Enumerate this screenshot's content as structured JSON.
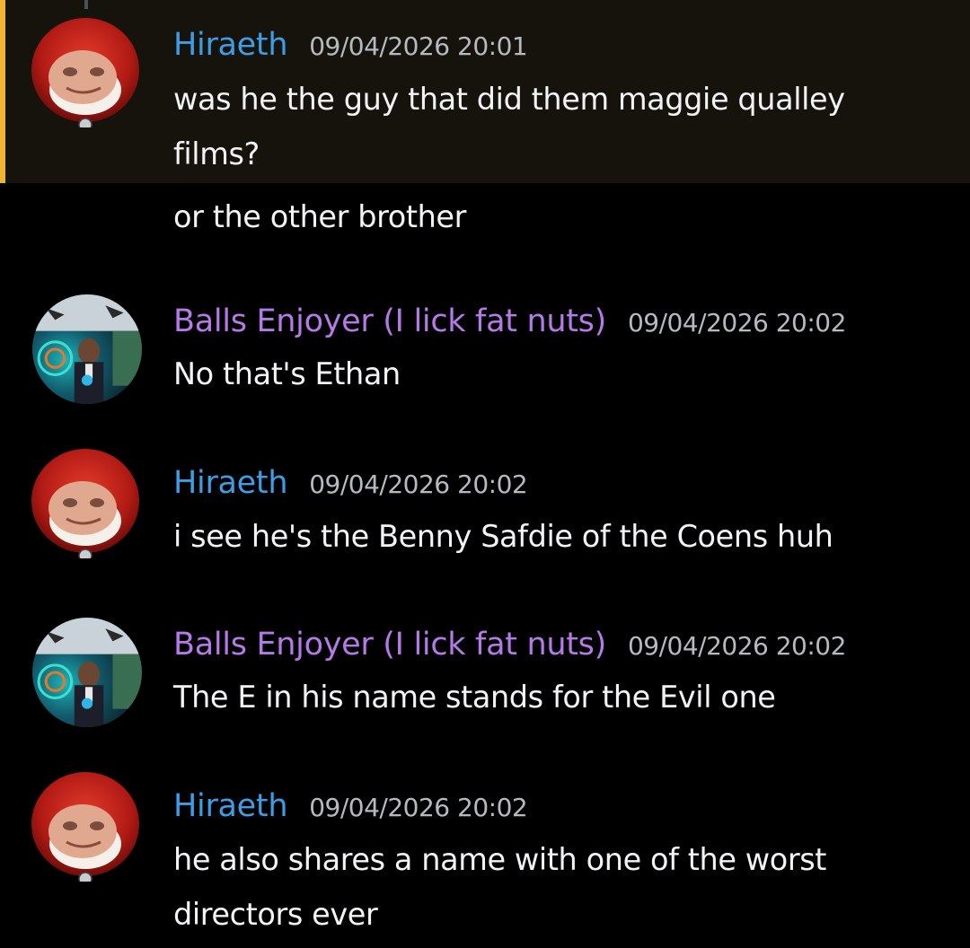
{
  "colors": {
    "background": "#000000",
    "highlight_background": "#16130c",
    "highlight_bar": "#f0b232",
    "username_hiraeth": "#3b9ee6",
    "username_balls": "#b67ae8",
    "message_text": "#f2f3f5",
    "timestamp_text": "#b5bac1"
  },
  "messages": [
    {
      "author": "Hiraeth",
      "timestamp": "09/04/2026 20:01",
      "lines": [
        "was he the guy that did them maggie qualley",
        "films?"
      ],
      "highlighted": true,
      "avatar": "hooded-face-avatar"
    },
    {
      "continuation": true,
      "lines": [
        "or the other brother"
      ]
    },
    {
      "author": "Balls Enjoyer (I lick fat nuts)",
      "timestamp": "09/04/2026 20:02",
      "lines": [
        "No that's Ethan"
      ],
      "avatar": "collage-avatar"
    },
    {
      "author": "Hiraeth",
      "timestamp": "09/04/2026 20:02",
      "lines": [
        "i see he's the Benny Safdie of the Coens huh"
      ],
      "avatar": "hooded-face-avatar"
    },
    {
      "author": "Balls Enjoyer (I lick fat nuts)",
      "timestamp": "09/04/2026 20:02",
      "lines": [
        "The E in his name stands for the Evil one"
      ],
      "avatar": "collage-avatar"
    },
    {
      "author": "Hiraeth",
      "timestamp": "09/04/2026 20:02",
      "lines": [
        "he also shares a name with one of the worst",
        "directors ever"
      ],
      "avatar": "hooded-face-avatar"
    }
  ]
}
